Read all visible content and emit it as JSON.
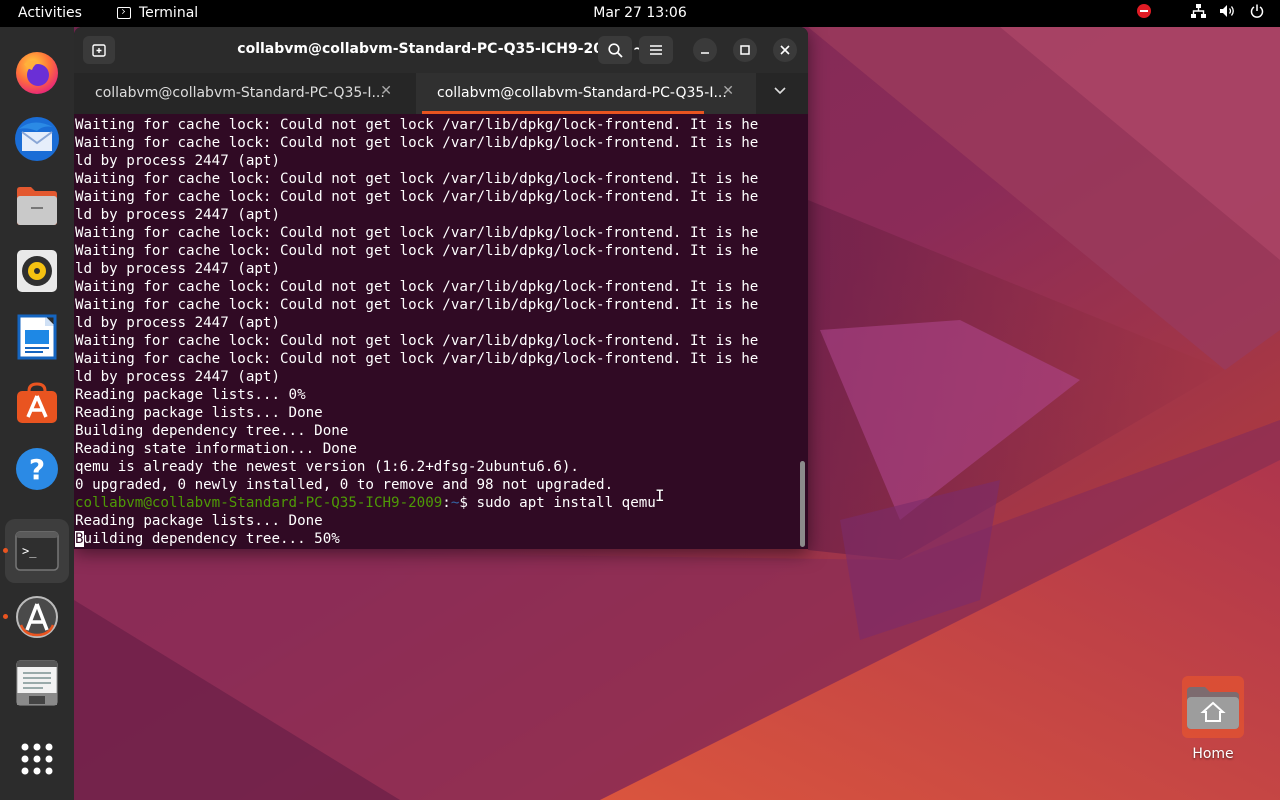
{
  "topbar": {
    "activities": "Activities",
    "app_name": "Terminal",
    "clock": "Mar 27  13:06"
  },
  "dock": {
    "items": [
      {
        "name": "firefox",
        "icon": "firefox-icon"
      },
      {
        "name": "thunderbird",
        "icon": "thunderbird-icon"
      },
      {
        "name": "files",
        "icon": "files-icon"
      },
      {
        "name": "rhythmbox",
        "icon": "rhythmbox-icon"
      },
      {
        "name": "libreoffice-writer",
        "icon": "writer-icon"
      },
      {
        "name": "ubuntu-software",
        "icon": "software-store-icon"
      },
      {
        "name": "help",
        "icon": "help-icon"
      },
      {
        "name": "terminal",
        "icon": "terminal-icon",
        "running": true,
        "focused": true
      },
      {
        "name": "software-updater",
        "icon": "software-updater-icon",
        "running": true
      },
      {
        "name": "text-editor",
        "icon": "text-editor-icon"
      },
      {
        "name": "show-applications",
        "icon": "app-grid-icon"
      }
    ]
  },
  "desktop": {
    "home_label": "Home"
  },
  "terminal": {
    "title": "collabvm@collabvm-Standard-PC-Q35-ICH9-2009: ~",
    "tabs": [
      {
        "label": "collabvm@collabvm-Standard-PC-Q35-I..."
      },
      {
        "label": "collabvm@collabvm-Standard-PC-Q35-I...",
        "active": true
      }
    ],
    "lines": [
      "Waiting for cache lock: Could not get lock /var/lib/dpkg/lock-frontend. It is he",
      "Waiting for cache lock: Could not get lock /var/lib/dpkg/lock-frontend. It is he",
      "ld by process 2447 (apt)",
      "Waiting for cache lock: Could not get lock /var/lib/dpkg/lock-frontend. It is he",
      "Waiting for cache lock: Could not get lock /var/lib/dpkg/lock-frontend. It is he",
      "ld by process 2447 (apt)",
      "Waiting for cache lock: Could not get lock /var/lib/dpkg/lock-frontend. It is he",
      "Waiting for cache lock: Could not get lock /var/lib/dpkg/lock-frontend. It is he",
      "ld by process 2447 (apt)",
      "Waiting for cache lock: Could not get lock /var/lib/dpkg/lock-frontend. It is he",
      "Waiting for cache lock: Could not get lock /var/lib/dpkg/lock-frontend. It is he",
      "ld by process 2447 (apt)",
      "Waiting for cache lock: Could not get lock /var/lib/dpkg/lock-frontend. It is he",
      "Waiting for cache lock: Could not get lock /var/lib/dpkg/lock-frontend. It is he",
      "ld by process 2447 (apt)",
      "Reading package lists... 0%",
      "Reading package lists... Done",
      "Building dependency tree... Done",
      "Reading state information... Done",
      "qemu is already the newest version (1:6.2+dfsg-2ubuntu6.6).",
      "0 upgraded, 0 newly installed, 0 to remove and 98 not upgraded."
    ],
    "prompt": {
      "user_host": "collabvm@collabvm-Standard-PC-Q35-ICH9-2009",
      "separator": ":",
      "path": "~",
      "symbol": "$",
      "command": " sudo apt install qemu"
    },
    "after_prompt": [
      "Reading package lists... Done"
    ],
    "current_line": {
      "cursor_char": "B",
      "rest": "uilding dependency tree... 50%"
    }
  },
  "colors": {
    "terminal_bg": "#300a24",
    "prompt_user": "#4e9a06",
    "prompt_path": "#3465a4",
    "accent": "#e95420"
  }
}
